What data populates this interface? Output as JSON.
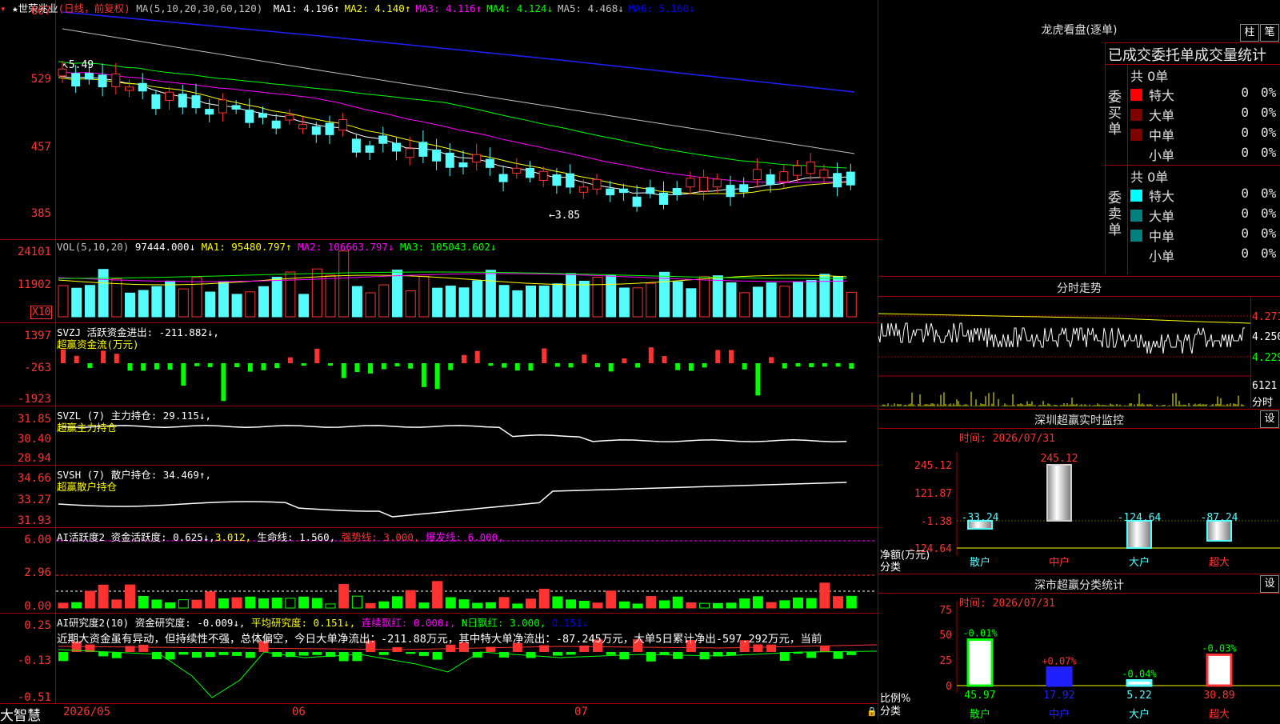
{
  "price_chart": {
    "title": "世荣兆业",
    "mode": "(日线，前复权)",
    "ma_label": "MA(5,10,20,30,60,120)",
    "ma_values": [
      {
        "name": "MA1:",
        "value": "4.196↑",
        "color": "#ffffff"
      },
      {
        "name": "MA2:",
        "value": "4.140↑",
        "color": "#ffff00"
      },
      {
        "name": "MA3:",
        "value": "4.116↑",
        "color": "#ff00ff"
      },
      {
        "name": "MA4:",
        "value": "4.124↓",
        "color": "#00ff00"
      },
      {
        "name": "MA5:",
        "value": "4.468↓",
        "color": "#c0c0c0"
      },
      {
        "name": "MA6:",
        "value": "5.160↓",
        "color": "#0000ff"
      }
    ],
    "y_labels": [
      "607",
      "529",
      "457",
      "385"
    ],
    "high_mark": "5.49",
    "low_mark": "3.85"
  },
  "volume_panel": {
    "title": "VOL(5,10,20)",
    "value": "97444.000↓",
    "ma1": "MA1: 95480.797↑",
    "ma2": "MA2: 106663.797↓",
    "ma3": "MA3: 105043.602↓",
    "y_labels": [
      "24101",
      "11902"
    ],
    "unit": "X10"
  },
  "svzj_panel": {
    "title": "SVZJ  活跃资金进出: -211.882↓,",
    "subtitle": "超赢资金流(万元)",
    "y_labels": [
      "1397",
      "-263",
      "-1923"
    ]
  },
  "svzl_panel": {
    "title": "SVZL (7) 主力持仓: 29.115↓,",
    "subtitle": "超赢主力持仓",
    "y_labels": [
      "31.85",
      "30.40",
      "28.94"
    ]
  },
  "svsh_panel": {
    "title": "SVSH (7) 散户持仓: 34.469↑,",
    "subtitle": "超赢散户持仓",
    "y_labels": [
      "34.66",
      "33.27",
      "31.93"
    ]
  },
  "ai_active_panel": {
    "title": "AI活跃度2 资金活跃度: 0.625↓,",
    "v2": "3.012,",
    "life": "生命线: 1.560,",
    "strong": "强势线: 3.000,",
    "burst": "爆发线: 6.000,",
    "y_labels": [
      "6.00",
      "2.96",
      "0.00"
    ]
  },
  "ai_research_panel": {
    "title": "AI研究度2(10) 资金研究度: -0.009↓,",
    "avg": "平均研究度: 0.151↓,",
    "cont": "连续飘红: 0.000↓,",
    "nday": "N日飘红: 3.000,",
    "v": "0.151↓",
    "comment": "近期大资金虽有异动，但持续性不强，总体偏空，今日大单净流出：-211.88万元，其中特大单净流出：-87.245万元，大单5日累计净出-597.292万元，当前",
    "y_labels": [
      "0.25",
      "-0.13",
      "-0.51"
    ]
  },
  "bottom_bar": {
    "brand": "大智慧",
    "dates": [
      "2026/05",
      "06",
      "07"
    ]
  },
  "dragon_panel": {
    "title": "龙虎看盘(逐单)",
    "tab1": "柱",
    "tab2": "笔",
    "header": "已成交委托单成交量统计",
    "buy_label": "委买单",
    "sell_label": "委卖单",
    "buy_total": "共 0单",
    "sell_total": "共 0单",
    "buy_rows": [
      {
        "name": "特大",
        "count": "0",
        "pct": "0%",
        "color": "#ff0000"
      },
      {
        "name": "大单",
        "count": "0",
        "pct": "0%",
        "color": "#800000"
      },
      {
        "name": "中单",
        "count": "0",
        "pct": "0%",
        "color": "#800000"
      },
      {
        "name": "小单",
        "count": "0",
        "pct": "0%",
        "color": ""
      }
    ],
    "sell_rows": [
      {
        "name": "特大",
        "count": "0",
        "pct": "0%",
        "color": "#00ffff"
      },
      {
        "name": "大单",
        "count": "0",
        "pct": "0%",
        "color": "#008080"
      },
      {
        "name": "中单",
        "count": "0",
        "pct": "0%",
        "color": "#008080"
      },
      {
        "name": "小单",
        "count": "0",
        "pct": "0%",
        "color": ""
      }
    ]
  },
  "intraday_panel": {
    "title": "分时走势",
    "y_labels": [
      "4.271",
      "4.250",
      "4.229"
    ],
    "vol_label": "6121",
    "unit_label": "分时"
  },
  "sz_monitor": {
    "title": "深圳超赢实时监控",
    "btn": "设",
    "time": "时间: 2026/07/31",
    "y_labels": [
      "245.12",
      "121.87",
      "-1.38",
      "-124.64"
    ],
    "axis_caption1": "净额(万元)",
    "axis_caption2": "分类",
    "categories": [
      "散户",
      "中户",
      "大户",
      "超大"
    ],
    "values": [
      "-33.24",
      "245.12",
      "-124.64",
      "-87.24"
    ]
  },
  "sz_class": {
    "title": "深市超赢分类统计",
    "btn": "设",
    "time": "时间: 2026/07/31",
    "y_labels": [
      "75",
      "50",
      "25",
      "0"
    ],
    "axis_caption1": "比例%",
    "axis_caption2": "分类",
    "categories": [
      "散户",
      "中户",
      "大户",
      "超大"
    ],
    "pct_change": [
      "-0.01%",
      "+0.07%",
      "-0.04%",
      "-0.03%"
    ],
    "values": [
      "45.97",
      "17.92",
      "5.22",
      "30.89"
    ]
  }
}
